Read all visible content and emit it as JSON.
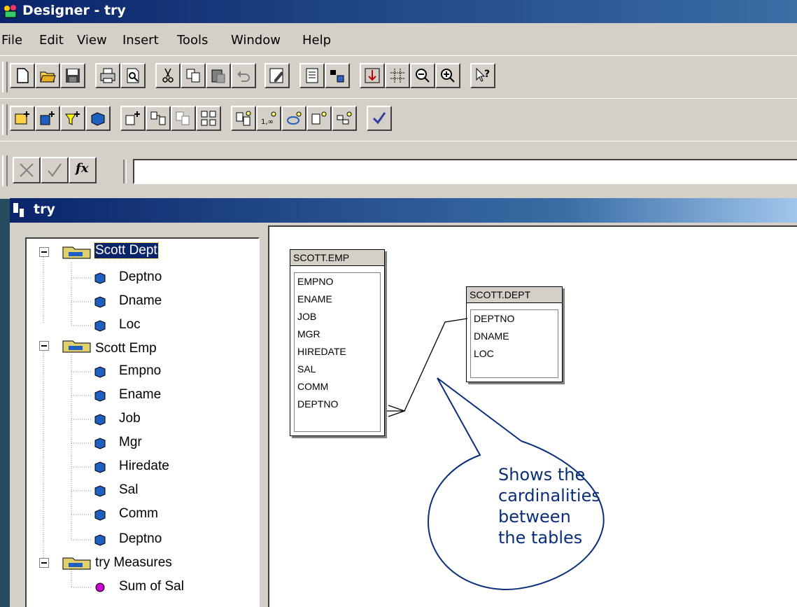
{
  "window": {
    "title": "Designer - try"
  },
  "menu": [
    "File",
    "Edit",
    "View",
    "Insert",
    "Tools",
    "Window",
    "Help"
  ],
  "toolbar1": [
    {
      "icon": "new-icon"
    },
    {
      "icon": "open-icon"
    },
    {
      "icon": "save-icon"
    },
    {
      "icon": "print-icon"
    },
    {
      "icon": "print-preview-icon"
    },
    {
      "icon": "cut-icon"
    },
    {
      "icon": "copy-icon"
    },
    {
      "icon": "paste-icon"
    },
    {
      "icon": "undo-icon"
    },
    {
      "icon": "properties-icon"
    },
    {
      "icon": "browse-data-icon"
    },
    {
      "icon": "dimension-icon"
    },
    {
      "icon": "arrange-icon"
    },
    {
      "icon": "grid-icon"
    },
    {
      "icon": "zoom-out-icon"
    },
    {
      "icon": "zoom-in-icon"
    },
    {
      "icon": "help-pointer-icon"
    }
  ],
  "toolbar2": [
    {
      "icon": "insert-data-source-icon"
    },
    {
      "icon": "insert-class-icon"
    },
    {
      "icon": "insert-filter-icon"
    },
    {
      "icon": "insert-cube-icon"
    },
    {
      "icon": "insert-table-icon"
    },
    {
      "icon": "insert-join-icon"
    },
    {
      "icon": "insert-alias-icon"
    },
    {
      "icon": "insert-context-icon"
    },
    {
      "icon": "detect-joins-icon"
    },
    {
      "icon": "detect-cardinalities-icon"
    },
    {
      "icon": "detect-loops-icon"
    },
    {
      "icon": "detect-aliases-icon"
    },
    {
      "icon": "detect-contexts-icon"
    },
    {
      "icon": "check-integrity-icon"
    }
  ],
  "formula_bar": {
    "cancel_icon": "cancel-x-icon",
    "ok_icon": "check-icon",
    "fx_label": "fx",
    "value": ""
  },
  "child_window": {
    "title": "try"
  },
  "tree": {
    "classes": [
      {
        "label": "Scott Dept",
        "selected": true,
        "items": [
          "Deptno",
          "Dname",
          "Loc"
        ]
      },
      {
        "label": "Scott Emp",
        "selected": false,
        "items": [
          "Empno",
          "Ename",
          "Job",
          "Mgr",
          "Hiredate",
          "Sal",
          "Comm",
          "Deptno"
        ]
      },
      {
        "label": "try Measures",
        "selected": false,
        "measures": [
          "Sum of Sal"
        ]
      }
    ]
  },
  "tables": {
    "emp": {
      "name": "SCOTT.EMP",
      "columns": [
        "EMPNO",
        "ENAME",
        "JOB",
        "MGR",
        "HIREDATE",
        "SAL",
        "COMM",
        "DEPTNO"
      ]
    },
    "dept": {
      "name": "SCOTT.DEPT",
      "columns": [
        "DEPTNO",
        "DNAME",
        "LOC"
      ]
    }
  },
  "callout": {
    "line1": "Shows the",
    "line2": "cardinalities",
    "line3": "between",
    "line4": "the tables"
  },
  "colors": {
    "title_bar": "#0a246a",
    "face": "#d4d0c8",
    "background": "#254d5f",
    "callout_text": "#0a2f7a",
    "measure": "#cc00cc",
    "object": "#1f5fbf"
  }
}
